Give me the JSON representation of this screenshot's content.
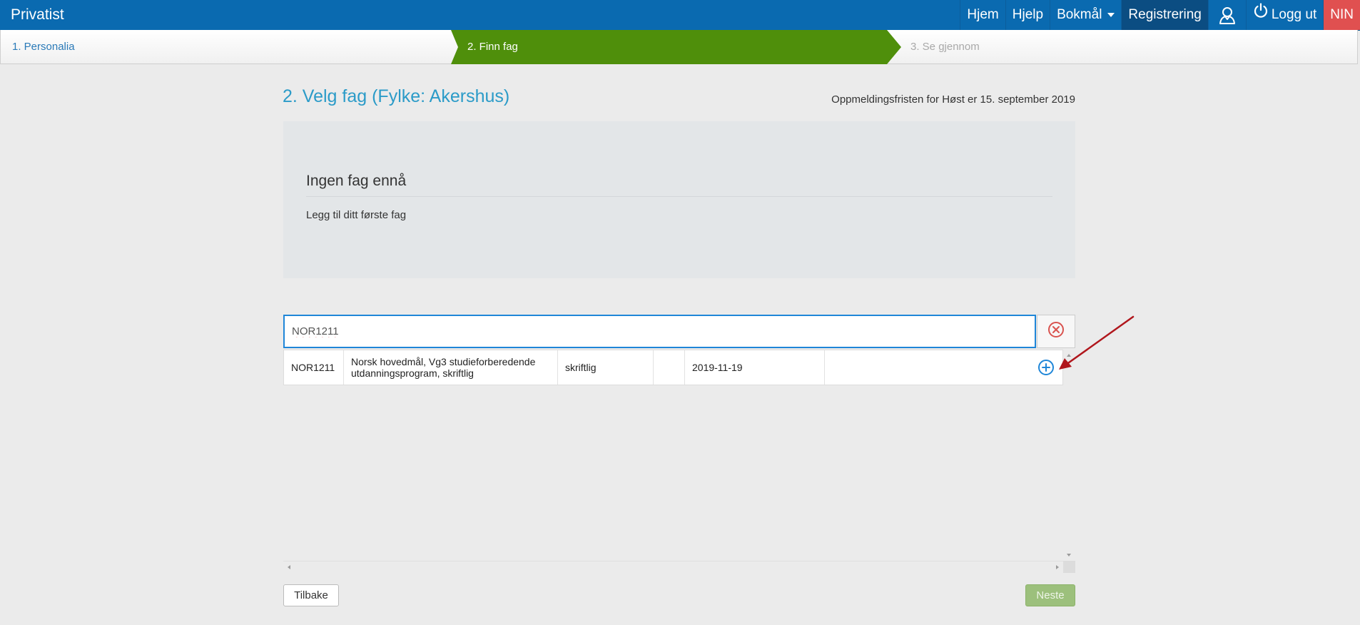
{
  "navbar": {
    "brand": "Privatist",
    "items": [
      {
        "label": "Hjem"
      },
      {
        "label": "Hjelp"
      },
      {
        "label": "Bokmål"
      },
      {
        "label": "Registrering"
      },
      {
        "label": "Logg ut"
      },
      {
        "label": "NIN"
      }
    ],
    "icons": [
      "user-icon",
      "power-icon"
    ],
    "colors": {
      "bar": "#0a6ab0",
      "active": "#0b4d82",
      "nin": "#e05050"
    }
  },
  "wizard": {
    "steps": [
      {
        "label": "1. Personalia",
        "state": "done"
      },
      {
        "label": "2. Finn fag",
        "state": "active"
      },
      {
        "label": "3. Se gjennom",
        "state": "pending"
      }
    ],
    "active_color": "#4f8f0b"
  },
  "main": {
    "title": "2. Velg fag (Fylke: Akershus)",
    "deadline": "Oppmeldingsfristen for Høst er 15. september 2019",
    "empty": {
      "title": "Ingen fag ennå",
      "text": "Legg til ditt første fag"
    }
  },
  "search": {
    "value": "NOR1211",
    "clear_icon": "close-circle-icon"
  },
  "results": {
    "rows": [
      {
        "code": "NOR1211",
        "name": "Norsk hovedmål, Vg3 studieforberedende utdanningsprogram, skriftlig",
        "type": "skriftlig",
        "extra": "",
        "date": "2019-11-19",
        "note": "",
        "action_icon": "add-circle-icon"
      }
    ]
  },
  "buttons": {
    "back": "Tilbake",
    "next": "Neste"
  }
}
